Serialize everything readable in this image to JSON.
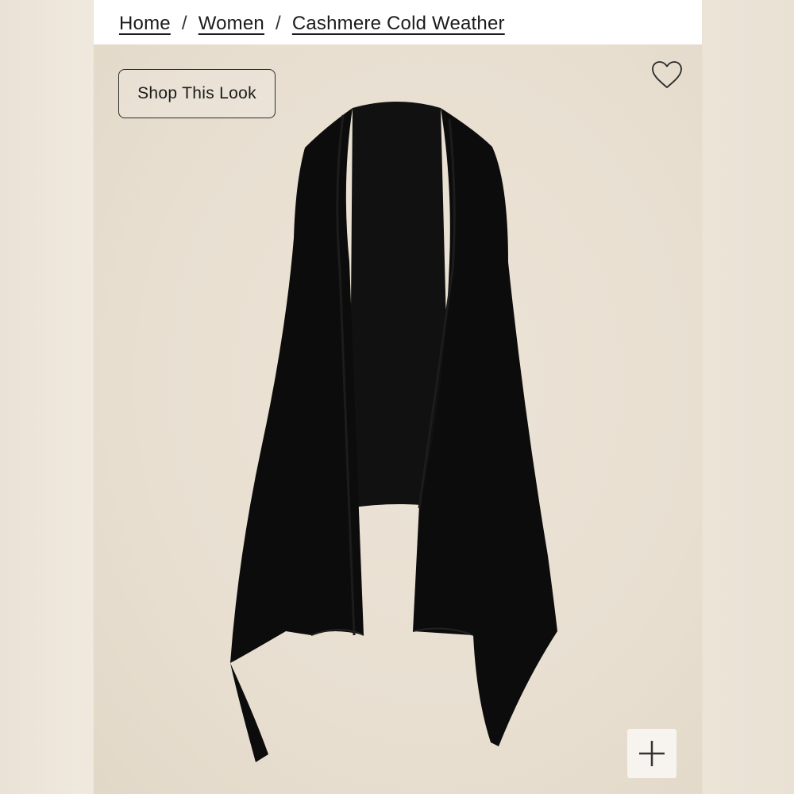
{
  "breadcrumb": {
    "items": [
      "Home",
      "Women",
      "Cashmere Cold Weather"
    ],
    "separator": "/"
  },
  "image": {
    "shop_this_look_label": "Shop This Look",
    "favorite_icon": "heart-outline-icon",
    "zoom_icon": "plus-icon"
  },
  "colors": {
    "background": "#e8dfd1",
    "garment": "#0f0f0f",
    "text": "#1b1b1b"
  }
}
